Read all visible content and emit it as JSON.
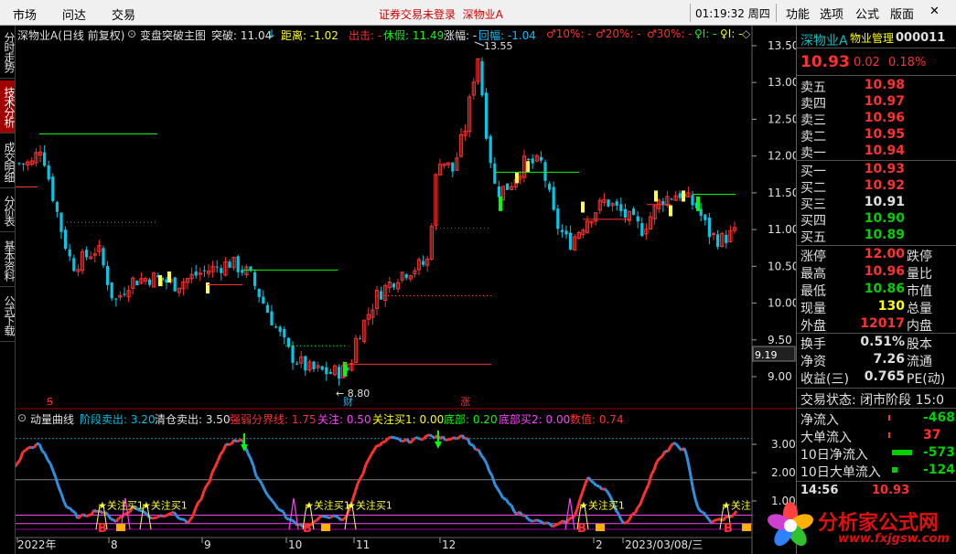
{
  "menubar": {
    "items": [
      "市场",
      "问达",
      "交易"
    ],
    "login_status": "证券交易未登录",
    "stock_name": "深物业A",
    "clock": "01:19:32 周四",
    "right_items": [
      "功能",
      "选项",
      "公式",
      "版面"
    ],
    "close_glyph": "✕"
  },
  "left_tabs": [
    "分时走势",
    "技术分析",
    "成交明细",
    "分价表",
    "基本资料",
    "公式下载"
  ],
  "main_header": {
    "title": "深物业A(日线 前复权)",
    "indicator": "变盘突破主图",
    "breakout_label": "突破: 11.04",
    "arrow_down": "↓",
    "distance_label": "距离: -1.02",
    "out_label": "出击: -",
    "rest_label": "休假: 11.49",
    "amplitude_label": "涨幅: -",
    "retrace_label": "回幅: -1.04",
    "pct10": "♂10%: -",
    "pct20": "♂20%: -",
    "pct30": "♂30%: -",
    "misc1": "♀I: -",
    "misc2": "♀I: -",
    "misc3": "◇"
  },
  "price_axis": {
    "ticks": [
      "13.50",
      "13.00",
      "12.50",
      "12.00",
      "11.50",
      "11.00",
      "10.50",
      "10.00",
      "9.50",
      "9.00"
    ],
    "cursor_value": "9.19"
  },
  "annotations": {
    "high": "13.55",
    "low": "8.80",
    "finance_marker": "财",
    "rise_marker": "涨",
    "s_marker": "Ꞩ"
  },
  "indicator_header": {
    "name": "动量曲线",
    "stage_sell": "阶段卖出: 3.20",
    "clear_sell": "清仓卖出: 3.50",
    "boundary": "强弱分界线: 1.75",
    "attention": "关注: 0.50",
    "attention_buy1": "关注买1: 0.00",
    "bottom": "底部: 0.20",
    "bottom_buy2": "底部买2: 0.00",
    "value": "数值: 0.74"
  },
  "indicator_axis": {
    "ticks": [
      "3.00",
      "2.00",
      "1.00"
    ]
  },
  "signal_labels": [
    "关注买1",
    "关注买1",
    "关注买1",
    "关注买1",
    "关注买1",
    "关注"
  ],
  "signal_markers": [
    "B",
    "B",
    "B",
    "B"
  ],
  "date_axis": [
    "2022年",
    "8",
    "9",
    "10",
    "11",
    "12",
    "2",
    "2023/03/08/三"
  ],
  "quote": {
    "stock_name": "深物业A",
    "industry": "物业管理",
    "code": "000011",
    "price": "10.93",
    "change": "0.02",
    "change_pct": "0.18%",
    "sells": [
      {
        "label": "卖五",
        "price": "10.98"
      },
      {
        "label": "卖四",
        "price": "10.97"
      },
      {
        "label": "卖三",
        "price": "10.96"
      },
      {
        "label": "卖二",
        "price": "10.95"
      },
      {
        "label": "卖一",
        "price": "10.94"
      }
    ],
    "buys": [
      {
        "label": "买一",
        "price": "10.93"
      },
      {
        "label": "买二",
        "price": "10.92"
      },
      {
        "label": "买三",
        "price": "10.91"
      },
      {
        "label": "买四",
        "price": "10.90"
      },
      {
        "label": "买五",
        "price": "10.89"
      }
    ],
    "stats": [
      {
        "label": "涨停",
        "value": "12.00",
        "label2": "跌停"
      },
      {
        "label": "最高",
        "value": "10.96",
        "label2": "量比"
      },
      {
        "label": "最低",
        "value": "10.86",
        "label2": "市值"
      },
      {
        "label": "现量",
        "value": "130",
        "label2": "总量"
      },
      {
        "label": "外盘",
        "value": "12017",
        "label2": "内盘"
      }
    ],
    "ratios": [
      {
        "label": "换手",
        "value": "0.51%",
        "label2": "股本"
      },
      {
        "label": "净资",
        "value": "7.26",
        "label2": "流通"
      },
      {
        "label": "收益(三)",
        "value": "0.765",
        "label2": "PE(动)"
      }
    ],
    "trade_status": "交易状态: 闭市阶段 15:0",
    "flows": [
      {
        "label": "净流入",
        "value": "-468"
      },
      {
        "label": "大单流入",
        "value": "37"
      },
      {
        "label": "10日净流入",
        "value": "-573"
      },
      {
        "label": "10日大单流入",
        "value": "-124"
      }
    ],
    "footer_time": "14:56",
    "footer_price": "10.93"
  },
  "watermark": {
    "text": "分析家公式网",
    "url": "www.fxjgsw.com"
  },
  "colors": {
    "up": "#ff3030",
    "down": "#00c0e0",
    "accent_yellow": "#ffff00",
    "accent_green": "#00ff00"
  }
}
